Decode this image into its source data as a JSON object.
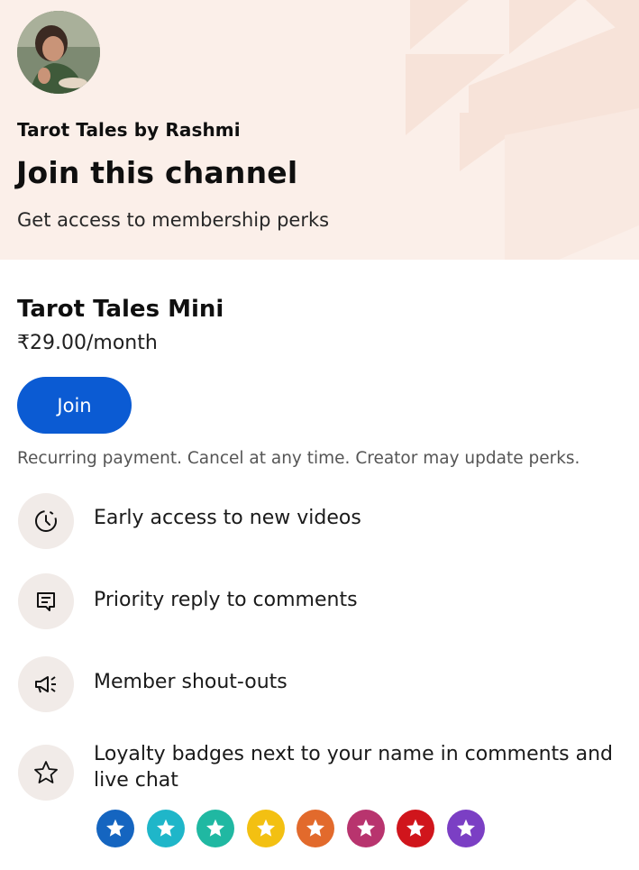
{
  "header": {
    "channel_name": "Tarot Tales by Rashmi",
    "title": "Join this channel",
    "subtitle": "Get access to membership perks",
    "avatar_icon": "avatar-photo"
  },
  "tier": {
    "name": "Tarot Tales Mini",
    "price": "₹29.00/month",
    "join_label": "Join",
    "disclaimer": "Recurring payment. Cancel at any time. Creator may update perks."
  },
  "perks": [
    {
      "icon": "clock-icon",
      "text": "Early access to new videos"
    },
    {
      "icon": "comment-icon",
      "text": "Priority reply to comments"
    },
    {
      "icon": "megaphone-icon",
      "text": "Member shout-outs"
    },
    {
      "icon": "star-outline-icon",
      "text": "Loyalty badges next to your name in comments and live chat"
    }
  ],
  "badges": [
    {
      "color": "#1565c0"
    },
    {
      "color": "#1fb6c9"
    },
    {
      "color": "#20b8a2"
    },
    {
      "color": "#f3c012"
    },
    {
      "color": "#e26a2c"
    },
    {
      "color": "#b8346e"
    },
    {
      "color": "#d0151c"
    },
    {
      "color": "#7b3fc4"
    }
  ],
  "colors": {
    "header_bg": "#fbefe9",
    "accent": "#0b5bd3"
  }
}
